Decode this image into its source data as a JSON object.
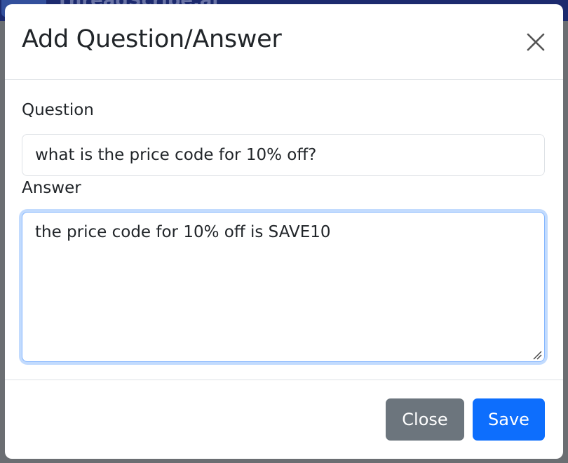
{
  "backdrop": {
    "brand_text": "ThreadScribe.ai"
  },
  "modal": {
    "title": "Add Question/Answer",
    "close_icon": "close-icon"
  },
  "form": {
    "question_label": "Question",
    "question_value": "what is the price code for 10% off?",
    "answer_label": "Answer",
    "answer_value": "the price code for 10% off is SAVE10"
  },
  "footer": {
    "close_label": "Close",
    "save_label": "Save"
  },
  "colors": {
    "primary": "#0d6efd",
    "secondary": "#6c757d",
    "focus_border": "#86b7fe"
  }
}
